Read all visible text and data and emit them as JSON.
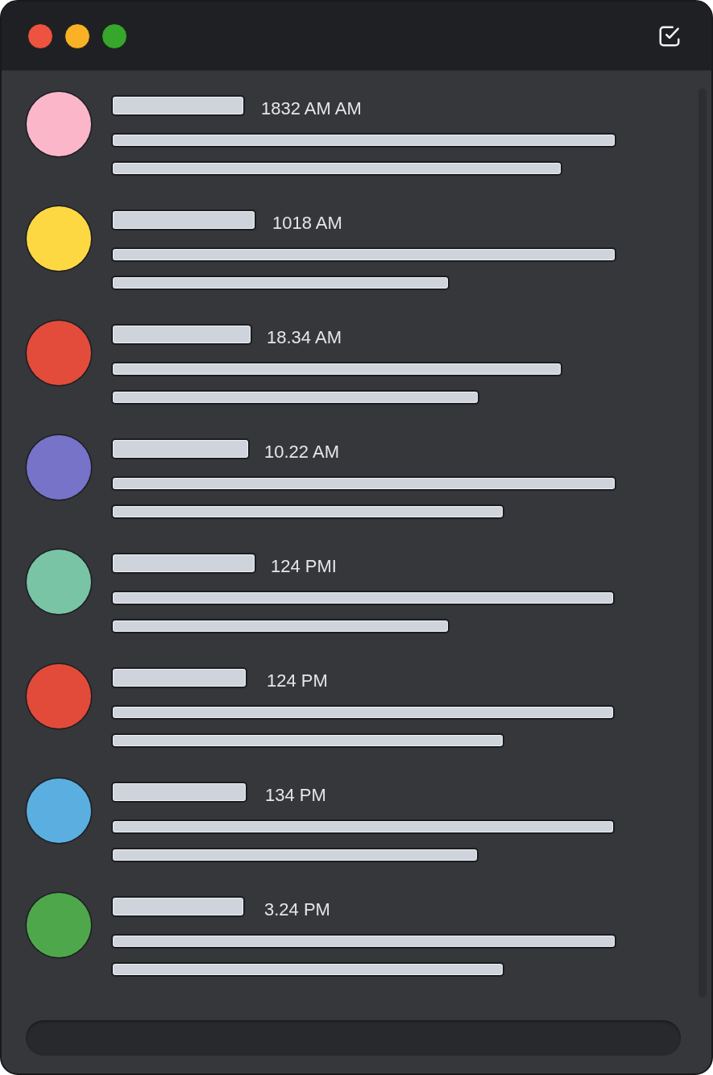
{
  "window": {
    "controls": [
      {
        "kind": "close"
      },
      {
        "kind": "minimize"
      },
      {
        "kind": "maximize"
      }
    ]
  },
  "messages": [
    {
      "color": "#fbb7c9",
      "time": "1832 AM AM"
    },
    {
      "color": "#fdd843",
      "time": "1018 AM"
    },
    {
      "color": "#e34b3a",
      "time": "18.34 AM"
    },
    {
      "color": "#7673c9",
      "time": "10.22 AM"
    },
    {
      "color": "#79c4a5",
      "time": "124 PMI"
    },
    {
      "color": "#e24a3a",
      "time": "124 PM"
    },
    {
      "color": "#5aafe0",
      "time": "134 PM"
    },
    {
      "color": "#4ea84b",
      "time": "3.24 PM"
    }
  ]
}
